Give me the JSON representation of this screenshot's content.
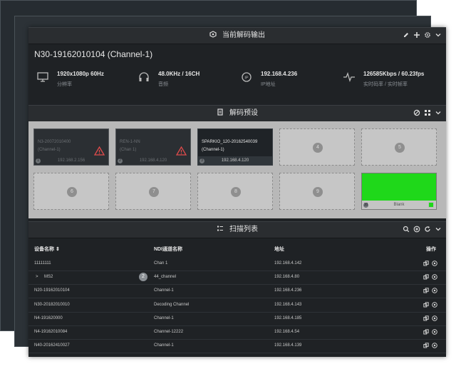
{
  "current_output": {
    "title": "当前解码输出",
    "device": "N30-19162010104 (Channel-1)",
    "stats": [
      {
        "value": "1920x1080p 60Hz",
        "label": "分辨率",
        "icon": "monitor-icon"
      },
      {
        "value": "48.0KHz / 16CH",
        "label": "音频",
        "icon": "headphones-icon"
      },
      {
        "value": "192.168.4.236",
        "label": "IP地址",
        "icon": "ip-icon"
      },
      {
        "value": "126585Kbps / 60.23fps",
        "label": "实时码率 / 实时帧率",
        "icon": "pulse-icon"
      }
    ]
  },
  "presets": {
    "title": "解码预设",
    "tiles": [
      {
        "num": "1",
        "line1": "N3-20072010400",
        "line2": "(Channel-1)",
        "ip": "192.168.2.156",
        "state": "offline",
        "warn": true
      },
      {
        "num": "2",
        "line1": "REN-1-NN",
        "line2": "(Chan 1)",
        "ip": "192.168.4.120",
        "state": "offline",
        "warn": true
      },
      {
        "num": "3",
        "line1": "SPARKIO_120-20162540039",
        "line2": "(Channel-1)",
        "ip": "192.168.4.120",
        "state": "active",
        "warn": false
      },
      {
        "num": "4",
        "state": "empty"
      },
      {
        "num": "5",
        "state": "empty"
      },
      {
        "num": "6",
        "state": "empty"
      },
      {
        "num": "7",
        "state": "empty"
      },
      {
        "num": "8",
        "state": "empty"
      },
      {
        "num": "9",
        "state": "empty"
      },
      {
        "num": "10",
        "state": "blank",
        "label": "Blank"
      }
    ]
  },
  "scan_list": {
    "title": "扫描列表",
    "headers": {
      "device": "设备名称",
      "channel": "NDI通道名称",
      "address": "地址",
      "actions": "操作"
    },
    "rows": [
      {
        "device": "11111111",
        "channel": "Chan 1",
        "address": "192.168.4.142"
      },
      {
        "device": "MS2",
        "channel": "44_channel",
        "address": "192.168.4.80",
        "expand": ">",
        "count": "2"
      },
      {
        "device": "N20-19162010104",
        "channel": "Channel-1",
        "address": "192.168.4.236"
      },
      {
        "device": "N30-20182010010",
        "channel": "Decoding Channel",
        "address": "192.168.4.143"
      },
      {
        "device": "N4-191620000",
        "channel": "Channel-1",
        "address": "192.168.4.185"
      },
      {
        "device": "N4-19162010084",
        "channel": "Channel-12222",
        "address": "192.168.4.54"
      },
      {
        "device": "N40-20162410027",
        "channel": "Channel-1",
        "address": "192.168.4.139"
      }
    ]
  },
  "colors": {
    "accent_green": "#1fd81a",
    "warning_red": "#e04b4b",
    "panel_bg": "#1f2225"
  }
}
